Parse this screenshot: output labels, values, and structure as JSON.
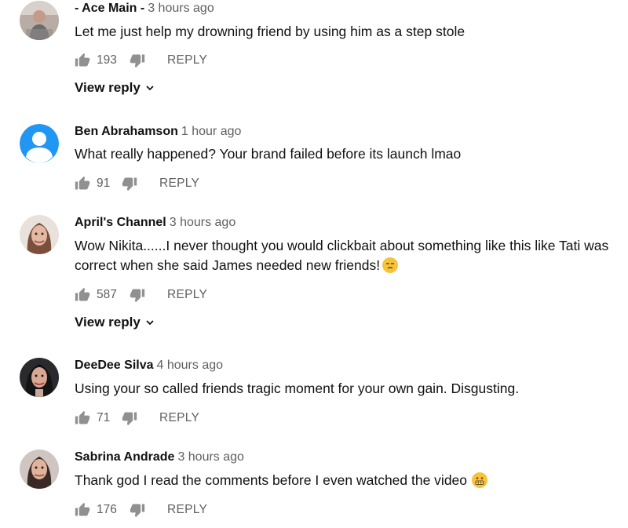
{
  "comments": [
    {
      "author": "- Ace Main -",
      "time": "3 hours ago",
      "text": "Let me just help my drowning friend by using him as a step stole",
      "likes": "193",
      "reply_label": "REPLY",
      "view_reply_label": "View reply"
    },
    {
      "author": "Ben Abrahamson",
      "time": "1 hour ago",
      "text": "What really happened? Your brand failed before its launch lmao",
      "likes": "91",
      "reply_label": "REPLY"
    },
    {
      "author": "April's Channel",
      "time": "3 hours ago",
      "text": "Wow Nikita......I never thought you would clickbait about something like this like Tati was correct when she said James needed new friends!",
      "likes": "587",
      "reply_label": "REPLY",
      "view_reply_label": "View reply"
    },
    {
      "author": "DeeDee Silva",
      "time": "4 hours ago",
      "text": "Using your so called friends tragic moment for your own gain. Disgusting.",
      "likes": "71",
      "reply_label": "REPLY"
    },
    {
      "author": "Sabrina Andrade",
      "time": "3 hours ago",
      "text": "Thank god I read the comments before I even watched the video",
      "likes": "176",
      "reply_label": "REPLY"
    }
  ],
  "icons": {
    "like": "thumbs-up-icon",
    "dislike": "thumbs-down-icon",
    "expand": "chevron-down-icon",
    "default_avatar": "default-avatar-icon",
    "emoji_unamused": "unamused-face-emoji",
    "emoji_grimace": "grimacing-face-emoji"
  },
  "colors": {
    "text": "#111111",
    "secondary": "#606060",
    "icon": "#909090",
    "default_avatar_bg": "#2196f3"
  }
}
